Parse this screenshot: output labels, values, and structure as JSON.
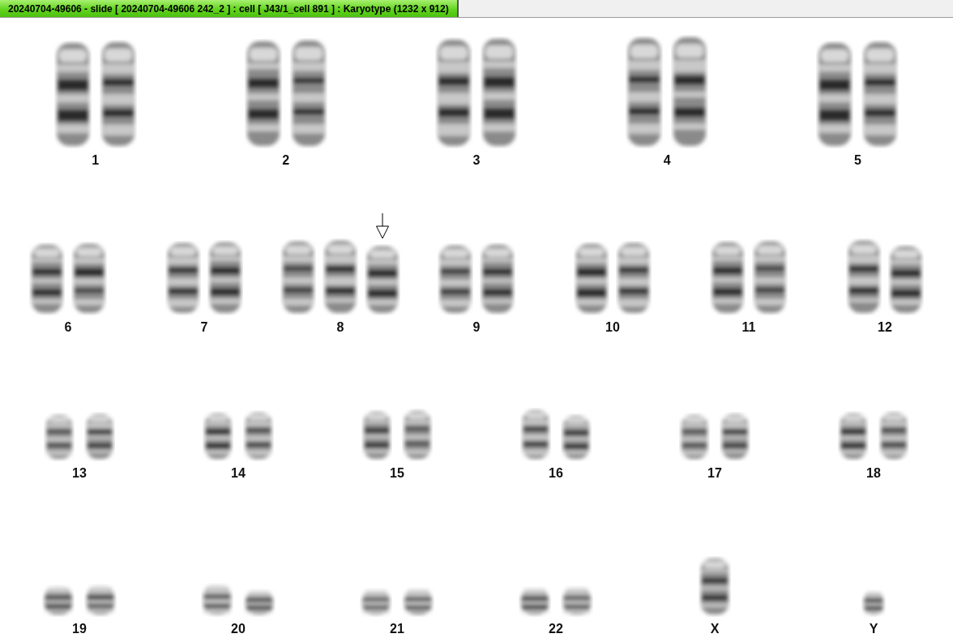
{
  "window": {
    "title": "20240704-49606 - slide [ 20240704-49606 242_2 ] : cell [ J43/1_cell 891 ] : Karyotype  (1232 x 912)"
  },
  "karyotype": {
    "rows": [
      {
        "groups": [
          {
            "label": "1",
            "homologs": [
              {
                "marked": false
              },
              {
                "marked": false
              }
            ]
          },
          {
            "label": "2",
            "homologs": [
              {
                "marked": false
              },
              {
                "marked": false
              }
            ]
          },
          {
            "label": "3",
            "homologs": [
              {
                "marked": false
              },
              {
                "marked": false
              }
            ]
          },
          {
            "label": "4",
            "homologs": [
              {
                "marked": false
              },
              {
                "marked": false
              }
            ]
          },
          {
            "label": "5",
            "homologs": [
              {
                "marked": false
              },
              {
                "marked": false
              }
            ]
          }
        ]
      },
      {
        "groups": [
          {
            "label": "6",
            "homologs": [
              {
                "marked": false
              },
              {
                "marked": false
              }
            ]
          },
          {
            "label": "7",
            "homologs": [
              {
                "marked": false
              },
              {
                "marked": false
              }
            ]
          },
          {
            "label": "8",
            "homologs": [
              {
                "marked": false
              },
              {
                "marked": false
              },
              {
                "marked": true
              }
            ]
          },
          {
            "label": "9",
            "homologs": [
              {
                "marked": false
              },
              {
                "marked": false
              }
            ]
          },
          {
            "label": "10",
            "homologs": [
              {
                "marked": false
              },
              {
                "marked": false
              }
            ]
          },
          {
            "label": "11",
            "homologs": [
              {
                "marked": false
              },
              {
                "marked": false
              }
            ]
          },
          {
            "label": "12",
            "homologs": [
              {
                "marked": false
              },
              {
                "marked": false
              }
            ]
          }
        ]
      },
      {
        "groups": [
          {
            "label": "13",
            "homologs": [
              {
                "marked": false
              },
              {
                "marked": false
              }
            ]
          },
          {
            "label": "14",
            "homologs": [
              {
                "marked": false
              },
              {
                "marked": false
              }
            ]
          },
          {
            "label": "15",
            "homologs": [
              {
                "marked": false
              },
              {
                "marked": false
              }
            ]
          },
          {
            "label": "16",
            "homologs": [
              {
                "marked": false
              },
              {
                "marked": false
              }
            ]
          },
          {
            "label": "17",
            "homologs": [
              {
                "marked": false
              },
              {
                "marked": false
              }
            ]
          },
          {
            "label": "18",
            "homologs": [
              {
                "marked": false
              },
              {
                "marked": false
              }
            ]
          }
        ]
      },
      {
        "groups": [
          {
            "label": "19",
            "homologs": [
              {
                "marked": false
              },
              {
                "marked": false
              }
            ]
          },
          {
            "label": "20",
            "homologs": [
              {
                "marked": false
              },
              {
                "marked": false
              }
            ]
          },
          {
            "label": "21",
            "homologs": [
              {
                "marked": false
              },
              {
                "marked": false
              }
            ]
          },
          {
            "label": "22",
            "homologs": [
              {
                "marked": false
              },
              {
                "marked": false
              }
            ]
          },
          {
            "label": "X",
            "homologs": [
              {
                "marked": false
              }
            ]
          },
          {
            "label": "Y",
            "homologs": [
              {
                "marked": false
              }
            ]
          }
        ]
      }
    ]
  }
}
